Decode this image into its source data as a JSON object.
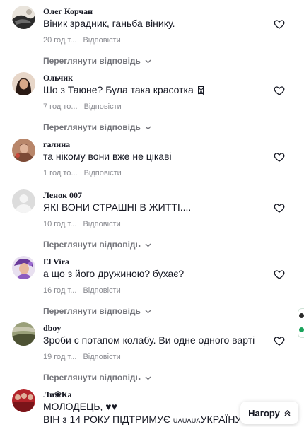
{
  "comments": [
    {
      "name": "Олег Корчан",
      "text": "Віник зрадник, ганьба вінику.",
      "time": "20 год т...",
      "reply": "Відповісти",
      "view_replies": "Переглянути відповідь",
      "avatar_color": "#3a3a3a"
    },
    {
      "name": "Ольчик",
      "text": "Шо з Таюне? Була така красотка",
      "time": "7 год то...",
      "reply": "Відповісти",
      "view_replies": "Переглянути відповідь",
      "avatar_color": "#5b2a2a"
    },
    {
      "name": "галина",
      "text": "та нікому вони вже не цікаві",
      "time": "1 год то...",
      "reply": "Відповісти",
      "avatar_color": "#a86b4a"
    },
    {
      "name": "Ленок 007",
      "text": "ЯКІ ВОНИ СТРАШНІ В ЖИТТІ....",
      "time": "10 год т...",
      "reply": "Відповісти",
      "view_replies": "Переглянути відповідь",
      "avatar_color": "#d8d8d8"
    },
    {
      "name": "El Vira",
      "text": "а що з його дружиною? бухає?",
      "time": "16 год т...",
      "reply": "Відповісти",
      "view_replies": "Переглянути відповідь",
      "avatar_color": "#7b4fa3"
    },
    {
      "name": "dboy",
      "text": "Зроби с потапом колабу. Ви одне одного варті",
      "time": "19 год т...",
      "reply": "Відповісти",
      "view_replies": "Переглянути відповідь",
      "avatar_color": "#6e7a4c"
    },
    {
      "name": "Ли❀Ка",
      "text_line1": "МОЛОДЕЦЬ, ♥♥",
      "text_line2_a": "ВІН з 14 РОКУ ПІДТРИМУЄ ",
      "text_line2_b": "UAUAUA",
      "text_line2_c": "УКРАЇНУ",
      "avatar_color": "#b3242a"
    }
  ],
  "back_to_top": "Нагору",
  "colors": {
    "text": "#161823",
    "meta": "#8a8b91",
    "replies": "#75767c"
  }
}
